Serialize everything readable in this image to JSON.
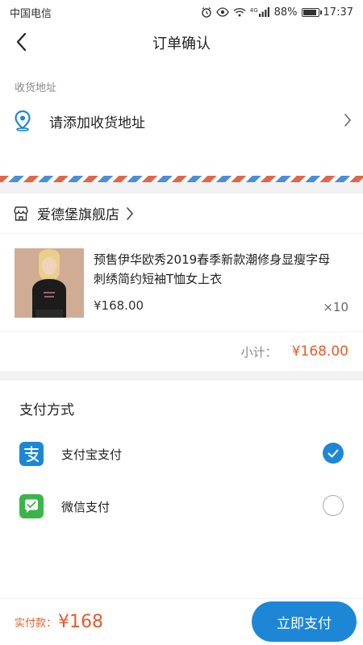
{
  "status_bar": {
    "carrier": "中国电信",
    "signal_type": "4G",
    "battery": "88%",
    "time": "17:37"
  },
  "nav": {
    "title": "订单确认"
  },
  "address": {
    "section_label": "收货地址",
    "add_prompt": "请添加收货地址"
  },
  "store": {
    "name": "爱德堡旗舰店"
  },
  "product": {
    "title": "预售伊华欧秀2019春季新款潮修身显瘦字母刺绣简约短袖T恤女上衣",
    "price": "¥168.00",
    "quantity": "×10"
  },
  "subtotal": {
    "label": "小计：",
    "value": "¥168.00"
  },
  "payment": {
    "title": "支付方式",
    "options": [
      {
        "label": "支付宝支付",
        "selected": true,
        "color": "#1d87d6"
      },
      {
        "label": "微信支付",
        "selected": false,
        "color": "#3bb54a"
      }
    ]
  },
  "bottom": {
    "amount_label": "实付款：",
    "amount_value": "¥168",
    "pay_button": "立即支付"
  },
  "colors": {
    "accent_blue": "#1d87d6",
    "price_orange": "#e85a2b",
    "airmail_red": "#e2664a",
    "airmail_blue": "#4b8fd8"
  }
}
